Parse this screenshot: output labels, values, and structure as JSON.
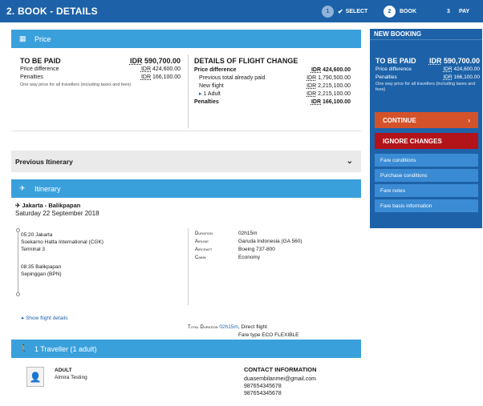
{
  "header": {
    "title": "2. BOOK - DETAILS",
    "steps": [
      {
        "num": "1",
        "label": "SELECT"
      },
      {
        "num": "2",
        "label": "BOOK"
      },
      {
        "num": "3",
        "label": "PAY"
      }
    ]
  },
  "price": {
    "section_title": "Price",
    "to_be_paid_label": "TO BE PAID",
    "currency": "IDR",
    "to_be_paid_value": "590,700.00",
    "price_difference_label": "Price difference",
    "price_difference_value": "424,600.00",
    "penalties_label": "Penalties",
    "penalties_value": "166,100.00",
    "note": "One way price for all travellers (including taxes and fees)",
    "details_title": "DETAILS OF FLIGHT CHANGE",
    "details": {
      "price_difference_label": "Price difference",
      "price_difference_value": "424,600.00",
      "previous_total_label": "Previous total already paid",
      "previous_total_value": "1,790,500.00",
      "new_flight_label": "New flight",
      "new_flight_value": "2,215,100.00",
      "adult_label": "1 Adult",
      "adult_value": "2,215,100.00",
      "penalties_label": "Penalties",
      "penalties_value": "166,100.00"
    }
  },
  "previous_itinerary": {
    "title": "Previous Itinerary"
  },
  "itinerary": {
    "section_title": "Itinerary",
    "route": "Jakarta - Balikpapan",
    "date": "Saturday 22 September 2018",
    "departure_time": "05:20",
    "departure_city": "Jakarta",
    "departure_airport": "Soekarno Hatta International (CGK)",
    "departure_terminal": "Terminal 3",
    "arrival_time": "08:35",
    "arrival_city": "Balikpapan",
    "arrival_airport": "Sepinggan (BPN)",
    "duration_label": "Duration",
    "duration_value": "02h15m",
    "airline_label": "Airline",
    "airline_value": "Garuda Indonesia (GA 560)",
    "aircraft_label": "Aircraft",
    "aircraft_value": "Boeing 737-800",
    "cabin_label": "Cabin",
    "cabin_value": "Economy",
    "show_details": "Show flight details",
    "total_duration_label": "Total Duration",
    "total_duration_value": "02h15m",
    "direct": ", Direct flight",
    "fare_type": "Fare type ECO FLEXIBLE"
  },
  "travellers": {
    "section_title": "1 Traveller (1 adult)",
    "type": "ADULT",
    "name": "Almira Testing",
    "contact_title": "CONTACT INFORMATION",
    "email": "duasembilanmei@gmail.com",
    "phone1": "987654345678",
    "phone2": "987654345678"
  },
  "sidebar": {
    "title": "NEW BOOKING",
    "to_be_paid_label": "TO BE PAID",
    "to_be_paid_value": "590,700.00",
    "price_difference_label": "Price difference",
    "price_difference_value": "424,600.00",
    "penalties_label": "Penalties",
    "penalties_value": "166,100.00",
    "note": "One way price for all travellers (including taxes and fees)",
    "continue_label": "CONTINUE",
    "ignore_label": "IGNORE CHANGES",
    "links": [
      "Fare conditions",
      "Purchase conditions",
      "Fare notes",
      "Fare basis information"
    ]
  },
  "colors": {
    "brand": "#1d62a8",
    "section": "#3aa0dc",
    "continue": "#d4522a",
    "ignore": "#b3141a"
  },
  "icons": [
    "check-icon",
    "price-icon",
    "chevron-down-icon",
    "plane-icon",
    "traveller-icon",
    "avatar-icon",
    "chevron-right-icon"
  ]
}
